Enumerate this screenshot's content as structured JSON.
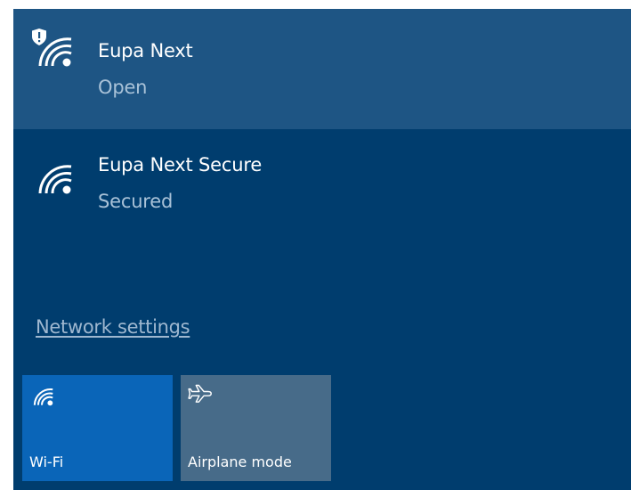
{
  "networks": [
    {
      "name": "Eupa Next",
      "status": "Open",
      "icon": "wifi-warning-icon",
      "selected": true
    },
    {
      "name": "Eupa Next Secure",
      "status": "Secured",
      "icon": "wifi-icon",
      "selected": false
    }
  ],
  "settings_link": "Network settings",
  "quick_actions": {
    "wifi": {
      "label": "Wi-Fi",
      "icon": "wifi-icon",
      "active": true
    },
    "airplane": {
      "label": "Airplane mode",
      "icon": "airplane-icon",
      "active": false
    }
  },
  "colors": {
    "panel_background": "#003d6e",
    "selected_item": "#1e5584",
    "wifi_tile_active": "#0a65b8",
    "airplane_tile": "#476b89",
    "secondary_text": "#a9c2d8",
    "link_text": "#9fb8d0"
  }
}
